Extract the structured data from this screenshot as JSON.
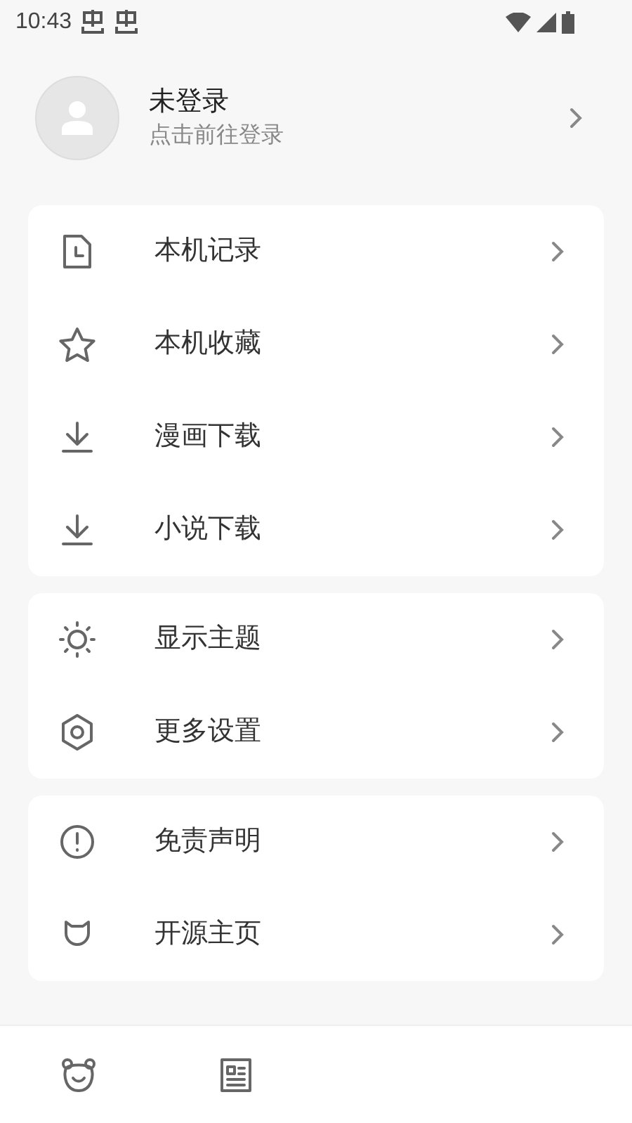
{
  "status_bar": {
    "time": "10:43"
  },
  "profile": {
    "name": "未登录",
    "subtitle": "点击前往登录"
  },
  "groups": [
    {
      "items": [
        {
          "kind": "history",
          "label": "本机记录"
        },
        {
          "kind": "star",
          "label": "本机收藏"
        },
        {
          "kind": "download",
          "label": "漫画下载"
        },
        {
          "kind": "download",
          "label": "小说下载"
        }
      ]
    },
    {
      "items": [
        {
          "kind": "theme",
          "label": "显示主题"
        },
        {
          "kind": "settings",
          "label": "更多设置"
        }
      ]
    },
    {
      "items": [
        {
          "kind": "info",
          "label": "免责声明"
        },
        {
          "kind": "github",
          "label": "开源主页"
        }
      ]
    }
  ],
  "bottom_nav": [
    {
      "kind": "bear"
    },
    {
      "kind": "list"
    }
  ]
}
